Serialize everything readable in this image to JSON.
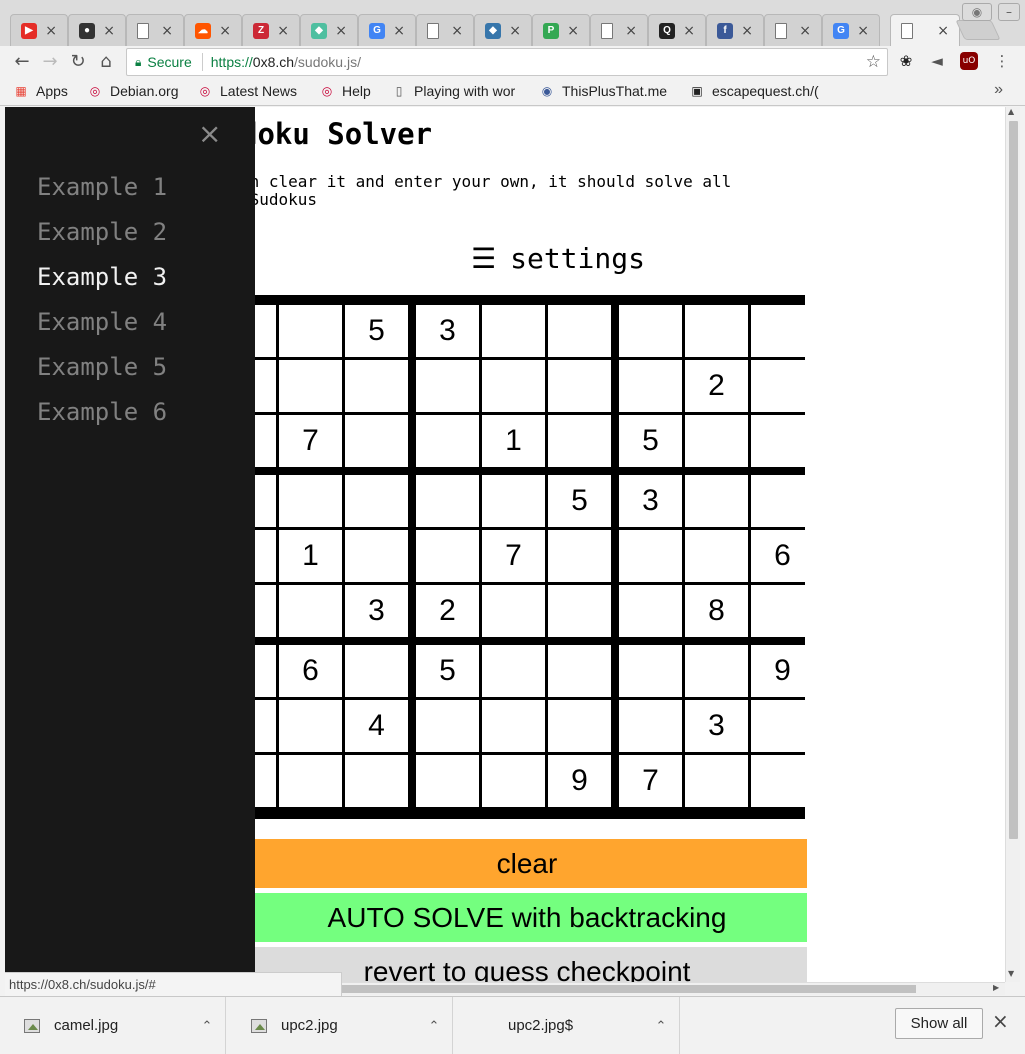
{
  "browser": {
    "tabs": [
      {
        "icon": "youtube-icon",
        "color": "#e52d27",
        "glyph": "▶",
        "close": "×"
      },
      {
        "icon": "github-icon",
        "color": "#333333",
        "glyph": "●",
        "close": "×"
      },
      {
        "icon": "page-icon",
        "color": "#ffffff",
        "glyph": "",
        "close": "×"
      },
      {
        "icon": "soundcloud-icon",
        "color": "#ff5500",
        "glyph": "☁",
        "close": "×"
      },
      {
        "icon": "zotero-icon",
        "color": "#cc2936",
        "glyph": "Z",
        "close": "×"
      },
      {
        "icon": "colorful-icon",
        "color": "#4fbfa0",
        "glyph": "◆",
        "close": "×"
      },
      {
        "icon": "google-icon",
        "color": "#4285f4",
        "glyph": "G",
        "close": "×"
      },
      {
        "icon": "page-icon",
        "color": "#ffffff",
        "glyph": "",
        "close": "×"
      },
      {
        "icon": "python-icon",
        "color": "#3776ab",
        "glyph": "◆",
        "close": "×"
      },
      {
        "icon": "p-icon",
        "color": "#34a853",
        "glyph": "P",
        "close": "×"
      },
      {
        "icon": "page-icon",
        "color": "#ffffff",
        "glyph": "",
        "close": "×"
      },
      {
        "icon": "quora-icon",
        "color": "#222222",
        "glyph": "Q",
        "close": "×"
      },
      {
        "icon": "facebook-icon",
        "color": "#3b5998",
        "glyph": "f",
        "close": "×"
      },
      {
        "icon": "page-icon",
        "color": "#ffffff",
        "glyph": "",
        "close": "×"
      },
      {
        "icon": "google-icon",
        "color": "#4285f4",
        "glyph": "G",
        "close": "×"
      },
      {
        "icon": "page-icon",
        "color": "#ffffff",
        "glyph": "",
        "close": "×",
        "active": true
      }
    ],
    "address": {
      "secure_label": "Secure",
      "scheme": "https://",
      "host": "0x8.ch",
      "path": "/sudoku.js/"
    },
    "bookmarks": [
      {
        "icon": "apps-icon",
        "label": "Apps"
      },
      {
        "icon": "debian-icon",
        "label": "Debian.org"
      },
      {
        "icon": "debian-icon",
        "label": "Latest News"
      },
      {
        "icon": "debian-icon",
        "label": "Help"
      },
      {
        "icon": "page-icon",
        "label": "Playing with wor"
      },
      {
        "icon": "globe-icon",
        "label": "ThisPlusThat.me"
      },
      {
        "icon": "escape-icon",
        "label": "escapequest.ch/("
      }
    ],
    "bookmarks_more": "»",
    "status_url": "https://0x8.ch/sudoku.js/#"
  },
  "page": {
    "title": "doku Solver",
    "description": "an clear it and enter your own, it should solve all\n Sudokus",
    "settings_icon": "☰",
    "settings_label": "settings",
    "sidebar": {
      "close": "×",
      "items": [
        "Example 1",
        "Example 2",
        "Example 3",
        "Example 4",
        "Example 5",
        "Example 6"
      ],
      "active_index": 2
    },
    "grid": [
      [
        "",
        "",
        "5",
        "3",
        "",
        "",
        "",
        "",
        ""
      ],
      [
        "",
        "",
        "",
        "",
        "",
        "",
        "",
        "2",
        ""
      ],
      [
        "",
        "7",
        "",
        "",
        "1",
        "",
        "5",
        "",
        ""
      ],
      [
        "",
        "",
        "",
        "",
        "",
        "5",
        "3",
        "",
        ""
      ],
      [
        "",
        "1",
        "",
        "",
        "7",
        "",
        "",
        "",
        "6"
      ],
      [
        "",
        "",
        "3",
        "2",
        "",
        "",
        "",
        "8",
        ""
      ],
      [
        "",
        "6",
        "",
        "5",
        "",
        "",
        "",
        "",
        "9"
      ],
      [
        "",
        "",
        "4",
        "",
        "",
        "",
        "",
        "3",
        ""
      ],
      [
        "",
        "",
        "",
        "",
        "",
        "9",
        "7",
        "",
        ""
      ]
    ],
    "buttons": {
      "clear": "clear",
      "auto_solve": "AUTO SOLVE with backtracking",
      "revert": "revert to guess checkpoint"
    },
    "colors": {
      "clear": "#ffa52e",
      "auto_solve": "#74ff7f",
      "revert": "#dcdcdc",
      "sidebar": "#181818"
    }
  },
  "downloads": {
    "items": [
      "camel.jpg",
      "upc2.jpg",
      "upc2.jpg$"
    ],
    "show_all": "Show all",
    "close": "×"
  }
}
